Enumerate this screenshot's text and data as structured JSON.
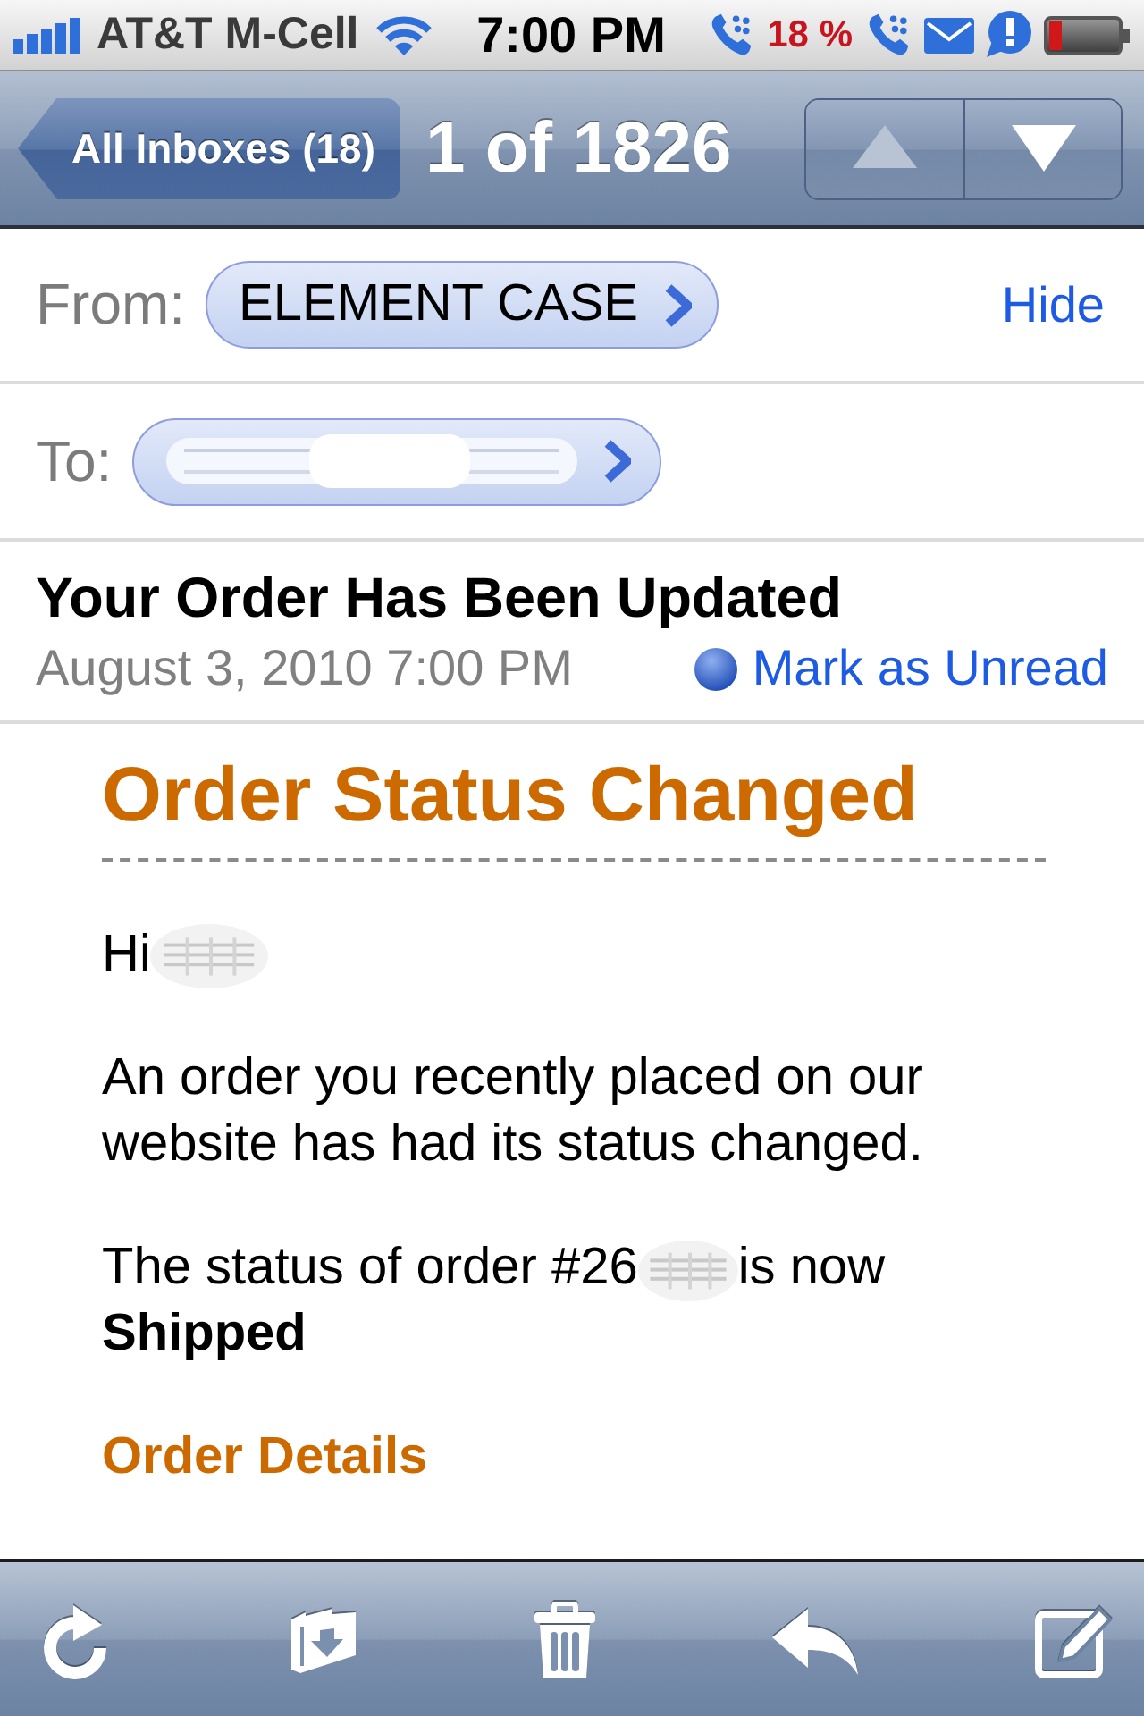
{
  "status_bar": {
    "carrier": "AT&T M-Cell",
    "time": "7:00 PM",
    "battery_percent": "18 %"
  },
  "nav_bar": {
    "back_button": "All Inboxes (18)",
    "title": "1 of 1826",
    "nav_buttons": [
      {
        "kind": "up",
        "disabled": true
      },
      {
        "kind": "down",
        "disabled": false
      }
    ]
  },
  "header": {
    "from_label": "From:",
    "sender": "ELEMENT CASE",
    "hide_link": "Hide",
    "to_label": "To:",
    "subject": "Your Order Has Been Updated",
    "date": "August 3, 2010 7:00 PM",
    "mark_unread": "Mark as Unread"
  },
  "body": {
    "heading": "Order Status Changed",
    "greeting": "Hi",
    "paragraph": "An order you recently placed on our website has had its status changed.",
    "status_text": "The status of order #26",
    "status_text_end": "is now",
    "status": "Shipped",
    "link": "Order Details"
  }
}
